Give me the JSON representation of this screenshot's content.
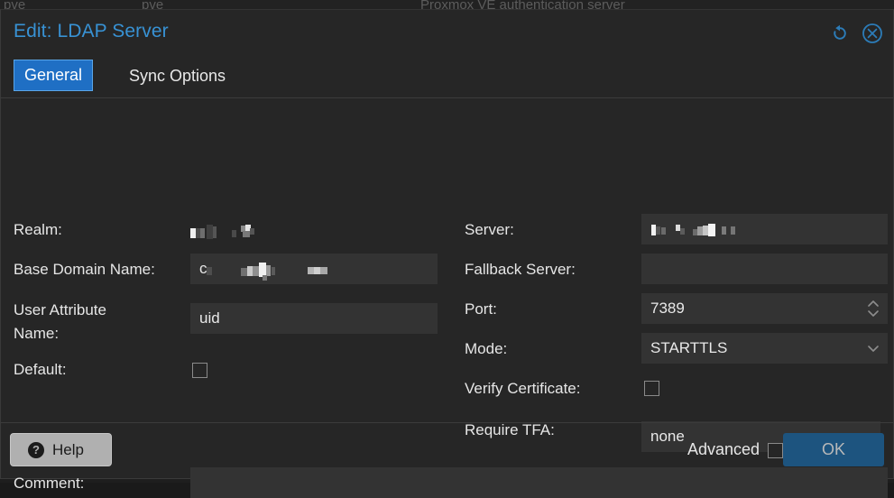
{
  "background": {
    "row_cells": [
      "pve",
      "pve",
      "Proxmox VE authentication server"
    ]
  },
  "dialog": {
    "title": "Edit: LDAP Server",
    "header_icons": {
      "reset": "reset-icon",
      "close": "close-icon"
    },
    "tabs": [
      {
        "label": "General",
        "active": true
      },
      {
        "label": "Sync Options",
        "active": false
      }
    ],
    "fields": {
      "realm": {
        "label": "Realm:",
        "value": "",
        "redacted": true
      },
      "base_domain_name": {
        "label": "Base Domain Name:",
        "value": "c",
        "redacted": true
      },
      "user_attribute_name": {
        "label": "User Attribute\nName:",
        "value": "uid",
        "placeholder": ""
      },
      "default": {
        "label": "Default:",
        "checked": false
      },
      "server": {
        "label": "Server:",
        "value": "",
        "redacted": true
      },
      "fallback_server": {
        "label": "Fallback Server:",
        "value": "",
        "placeholder": ""
      },
      "port": {
        "label": "Port:",
        "value": "7389"
      },
      "mode": {
        "label": "Mode:",
        "value": "STARTTLS"
      },
      "verify_certificate": {
        "label": "Verify Certificate:",
        "checked": false
      },
      "require_tfa": {
        "label": "Require TFA:",
        "value": "none"
      },
      "comment": {
        "label": "Comment:",
        "value": "",
        "placeholder": ""
      }
    },
    "footer": {
      "help_label": "Help",
      "help_icon": "question-mark-icon",
      "advanced_label": "Advanced",
      "advanced_checked": false,
      "ok_label": "OK"
    }
  },
  "colors": {
    "accent_blue": "#3892d4",
    "tab_active_bg": "#1f6fc4",
    "ok_button_bg": "#1d547f",
    "dialog_bg": "#262626",
    "input_bg": "#333333"
  }
}
